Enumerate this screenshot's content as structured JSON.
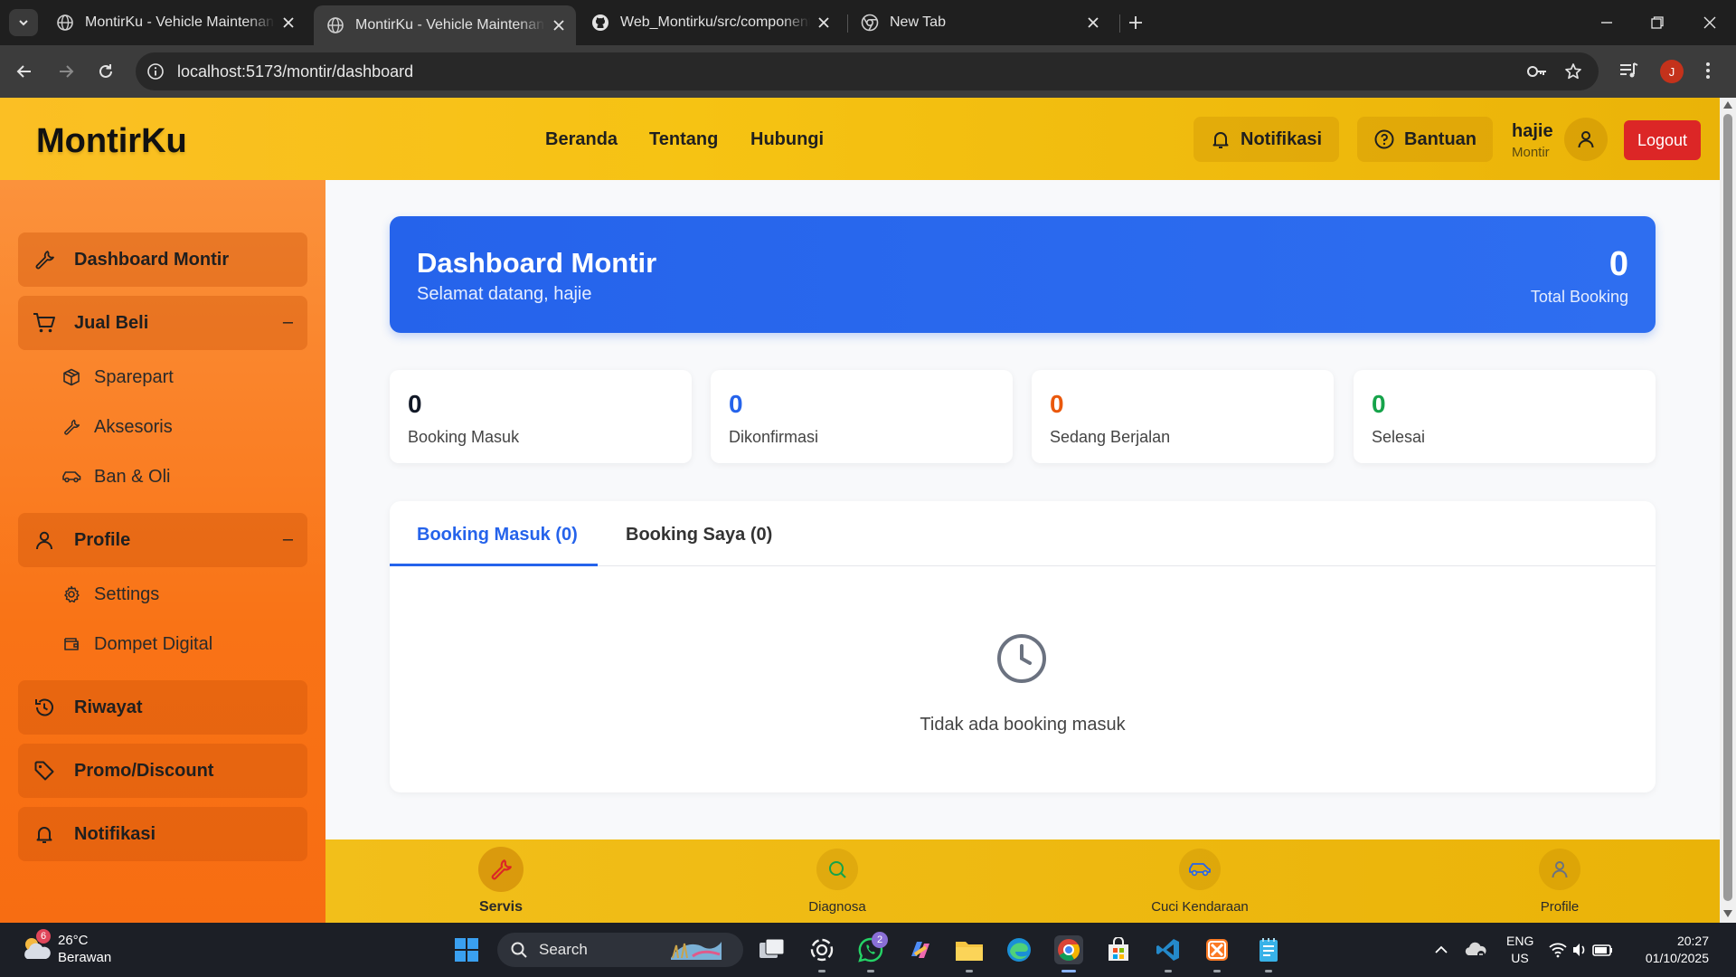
{
  "browser": {
    "tabs": [
      {
        "title": "MontirKu - Vehicle Maintenance"
      },
      {
        "title": "MontirKu - Vehicle Maintenance"
      },
      {
        "title": "Web_Montirku/src/components"
      },
      {
        "title": "New Tab"
      }
    ],
    "url": "localhost:5173/montir/dashboard",
    "profile_initial": "J"
  },
  "header": {
    "brand": "MontirKu",
    "nav": [
      "Beranda",
      "Tentang",
      "Hubungi"
    ],
    "notif_label": "Notifikasi",
    "help_label": "Bantuan",
    "user_name": "hajie",
    "user_role": "Montir",
    "logout_label": "Logout"
  },
  "sidebar": {
    "dashboard": "Dashboard Montir",
    "jual_beli": "Jual Beli",
    "jual_beli_collapse": "–",
    "jual_beli_items": [
      "Sparepart",
      "Aksesoris",
      "Ban & Oli"
    ],
    "profile": "Profile",
    "profile_collapse": "–",
    "profile_items": [
      "Settings",
      "Dompet Digital"
    ],
    "riwayat": "Riwayat",
    "promo": "Promo/Discount",
    "notifikasi": "Notifikasi"
  },
  "welcome": {
    "title": "Dashboard Montir",
    "subtitle": "Selamat datang, hajie",
    "total_value": "0",
    "total_label": "Total Booking"
  },
  "stats": [
    {
      "value": "0",
      "label": "Booking Masuk",
      "color": "#111827"
    },
    {
      "value": "0",
      "label": "Dikonfirmasi",
      "color": "#2563eb"
    },
    {
      "value": "0",
      "label": "Sedang Berjalan",
      "color": "#ea580c"
    },
    {
      "value": "0",
      "label": "Selesai",
      "color": "#16a34a"
    }
  ],
  "booking_tabs": {
    "tab_masuk": "Booking Masuk (0)",
    "tab_saya": "Booking Saya (0)",
    "empty_text": "Tidak ada booking masuk"
  },
  "bottom_nav": {
    "servis": "Servis",
    "diagnosa": "Diagnosa",
    "cuci": "Cuci Kendaraan",
    "profile": "Profile"
  },
  "taskbar": {
    "temperature": "26°C",
    "weather": "Berawan",
    "weather_badge": "6",
    "search_label": "Search",
    "whatsapp_badge": "2",
    "lang_1": "ENG",
    "lang_2": "US",
    "time": "20:27",
    "date": "01/10/2025"
  },
  "colors": {
    "accent_blue": "#2563eb",
    "header_yellow": "#fbbf24",
    "sidebar_orange": "#f97316",
    "logout_red": "#dc2626"
  }
}
